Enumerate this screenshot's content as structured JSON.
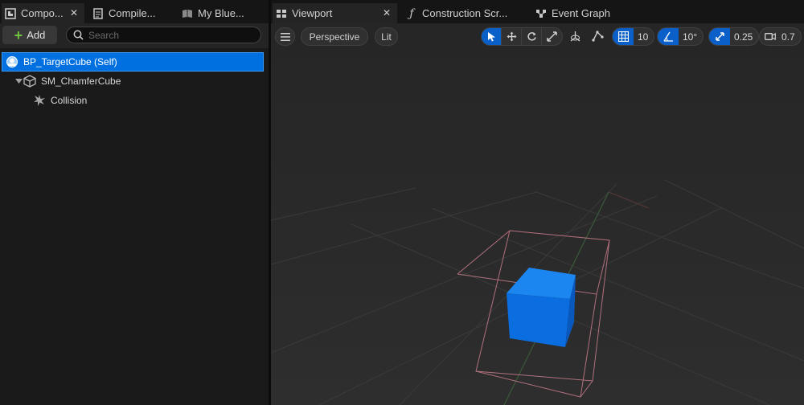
{
  "tabs": {
    "components": {
      "label": "Compo..."
    },
    "compile": {
      "label": "Compile..."
    },
    "my_blueprint": {
      "label": "My Blue..."
    },
    "viewport": {
      "label": "Viewport"
    },
    "construction_script": {
      "label": "Construction Scr..."
    },
    "event_graph": {
      "label": "Event Graph"
    },
    "close_glyph": "✕"
  },
  "components_panel": {
    "add_label": "Add",
    "search_placeholder": "Search",
    "tree": [
      {
        "label": "BP_TargetCube (Self)",
        "icon": "blueprint-self-icon"
      },
      {
        "label": "SM_ChamferCube",
        "icon": "static-mesh-icon"
      },
      {
        "label": "Collision",
        "icon": "collision-icon"
      }
    ]
  },
  "viewport_toolbar": {
    "perspective": "Perspective",
    "lit": "Lit",
    "grid_snap": "10",
    "rotation_snap": "10°",
    "scale_snap": "0.25",
    "camera_speed": "0.7"
  },
  "colors": {
    "selection": "#0070e0",
    "accent_blue": "#0a5fc8",
    "cube": "#0a6ee0",
    "bounds": "#c87d8c"
  }
}
